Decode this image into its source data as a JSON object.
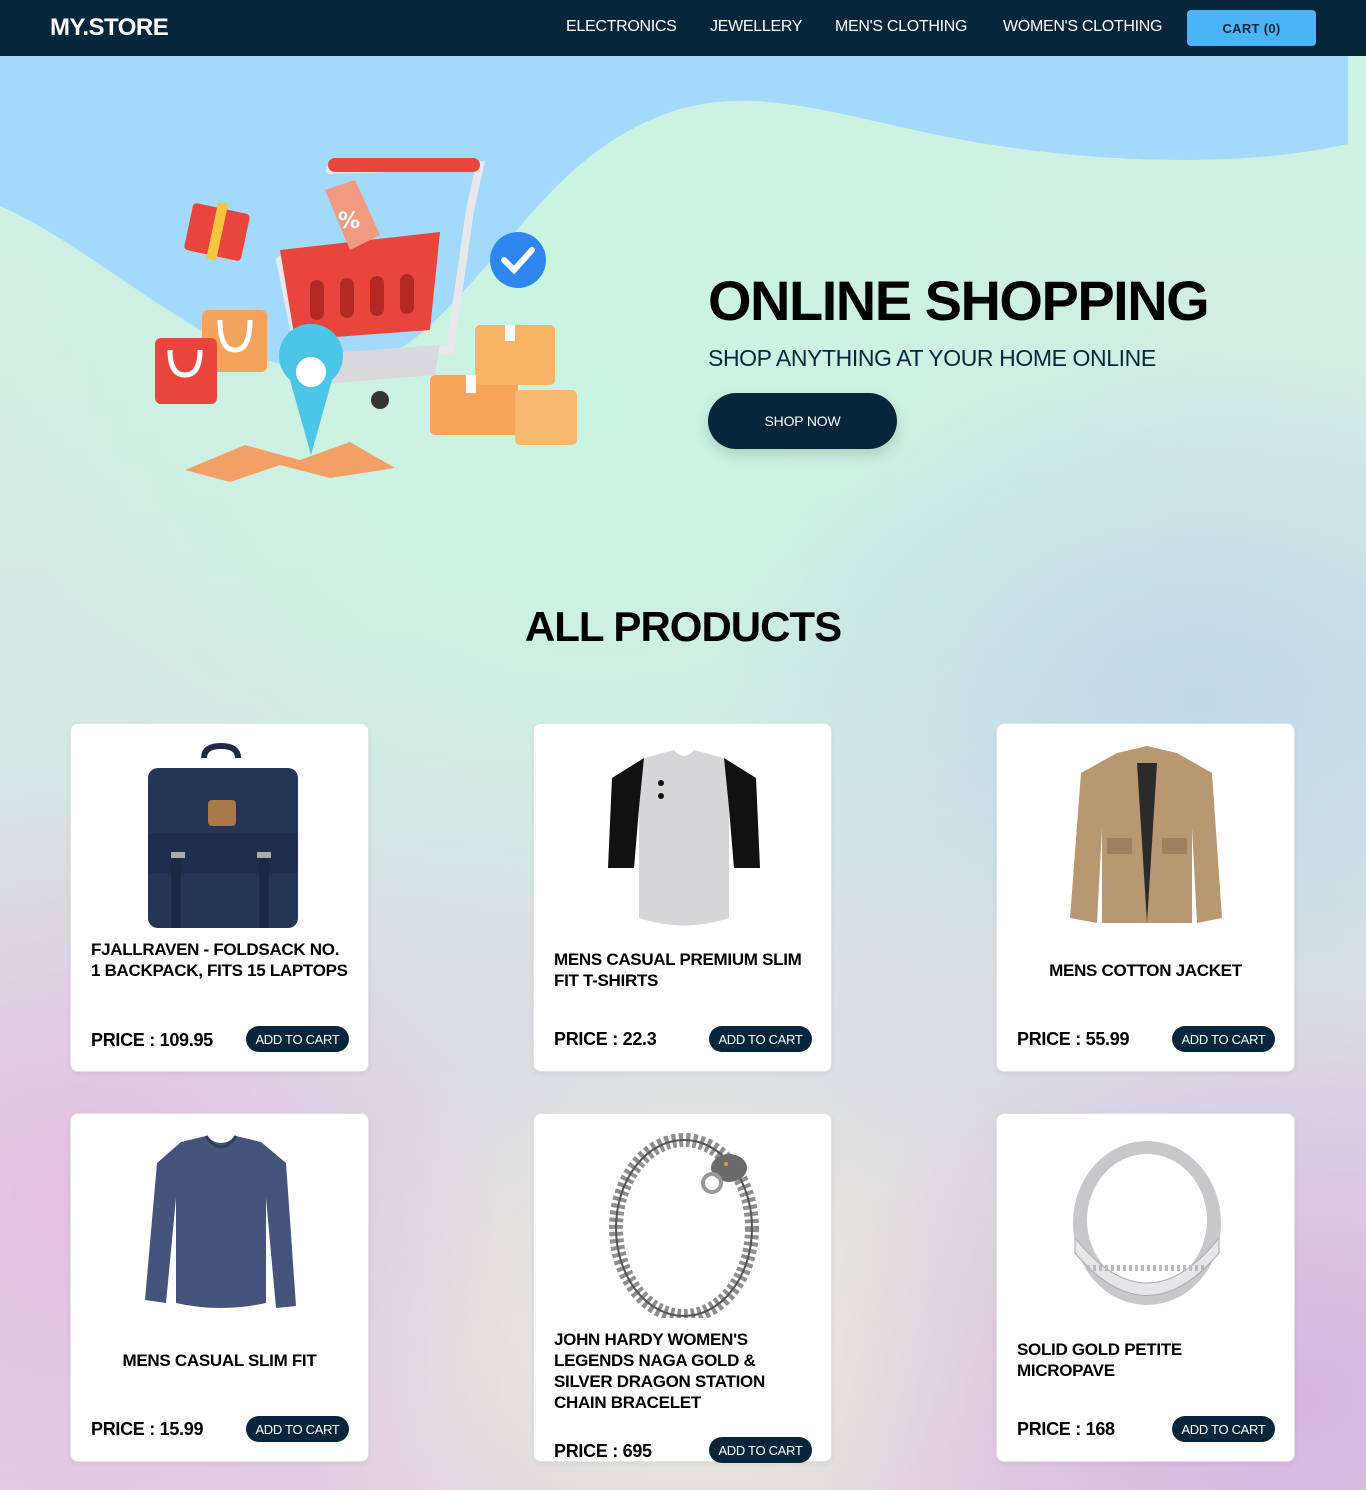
{
  "nav": {
    "logo": "MY.STORE",
    "links": [
      "ELECTRONICS",
      "JEWELLERY",
      "MEN'S CLOTHING",
      "WOMEN'S CLOTHING"
    ],
    "cart_label": "CART (0)"
  },
  "hero": {
    "title": "ONLINE SHOPPING",
    "subtitle": "SHOP ANYTHING AT YOUR HOME ONLINE",
    "button": "SHOP NOW"
  },
  "products_title": "ALL PRODUCTS",
  "products": [
    {
      "name": "FJALLRAVEN - FOLDSACK NO. 1 BACKPACK, FITS 15 LAPTOPS",
      "price_label": "PRICE : 109.95",
      "button": "ADD TO CART",
      "image": "backpack"
    },
    {
      "name": "MENS CASUAL PREMIUM SLIM FIT T-SHIRTS",
      "price_label": "PRICE : 22.3",
      "button": "ADD TO CART",
      "image": "t-shirt"
    },
    {
      "name": "MENS COTTON JACKET",
      "price_label": "PRICE : 55.99",
      "button": "ADD TO CART",
      "image": "jacket"
    },
    {
      "name": "MENS CASUAL SLIM FIT",
      "price_label": "PRICE : 15.99",
      "button": "ADD TO CART",
      "image": "long-sleeve-shirt"
    },
    {
      "name": "JOHN HARDY WOMEN'S LEGENDS NAGA GOLD & SILVER DRAGON STATION CHAIN BRACELET",
      "price_label": "PRICE : 695",
      "button": "ADD TO CART",
      "image": "bracelet"
    },
    {
      "name": "SOLID GOLD PETITE MICROPAVE",
      "price_label": "PRICE : 168",
      "button": "ADD TO CART",
      "image": "ring"
    }
  ],
  "colors": {
    "navbar": "#06263c",
    "cart_button": "#4ab4f7",
    "hero_sky": "#a3d9fb",
    "button_dark": "#06263c"
  }
}
